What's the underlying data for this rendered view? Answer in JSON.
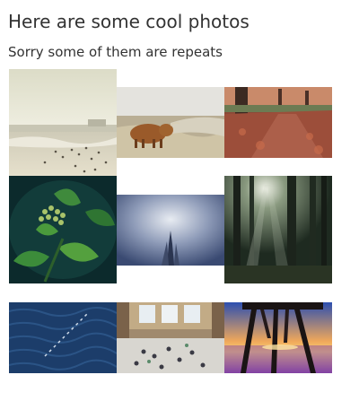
{
  "header": {
    "title": "Here are some cool photos",
    "subtitle": "Sorry some of them are repeats"
  },
  "photos": [
    {
      "id": "beach",
      "subject": "beach-crowd"
    },
    {
      "id": "cow",
      "subject": "highland-cow"
    },
    {
      "id": "trees",
      "subject": "autumn-trees"
    },
    {
      "id": "plant",
      "subject": "green-plant-buds"
    },
    {
      "id": "tower",
      "subject": "skyscraper-clouds"
    },
    {
      "id": "forest",
      "subject": "misty-forest"
    },
    {
      "id": "ocean",
      "subject": "ocean-waves"
    },
    {
      "id": "station",
      "subject": "grand-central-hall"
    },
    {
      "id": "pier",
      "subject": "pier-sunset"
    }
  ]
}
